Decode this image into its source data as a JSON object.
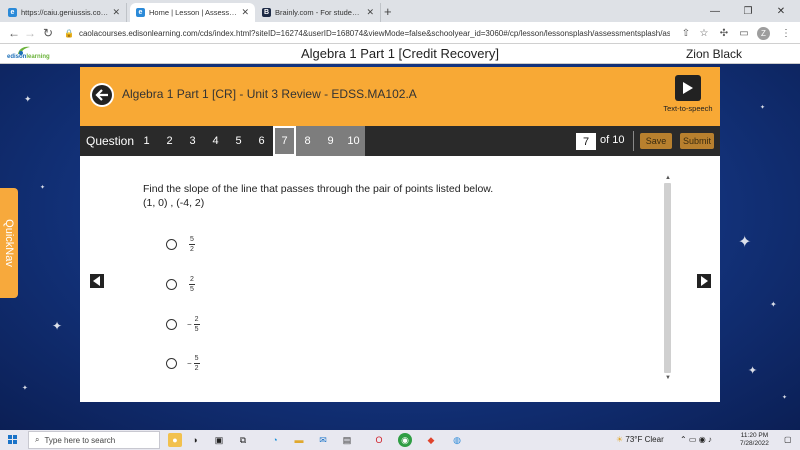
{
  "browser": {
    "tabs": [
      {
        "title": "https://caiu.geniussis.com/FEDash...",
        "favicon": "e",
        "favicon_color": "#2b8ad8",
        "active": false
      },
      {
        "title": "Home | Lesson | Assessment Player",
        "favicon": "e",
        "favicon_color": "#2b8ad8",
        "active": true
      },
      {
        "title": "Brainly.com - For students. By stu...",
        "favicon": "B",
        "favicon_color": "#1d2a45",
        "active": false
      }
    ],
    "new_tab": "+",
    "url": "caolacourses.edisonlearning.com/cds/index.html?siteID=16274&userID=168074&viewMode=false&schoolyear_id=3060#/cp/lesson/lessonsplash/assessmentsplash/assessmentplayer",
    "profile_initial": "Z"
  },
  "site": {
    "logo_word_a": "edison",
    "logo_word_b": "learning",
    "course_title": "Algebra 1 Part 1 [Credit Recovery]",
    "user_name": "Zion Black"
  },
  "quicknav": {
    "label": "QuickNav"
  },
  "lesson": {
    "title": "Algebra 1 Part 1 [CR] - Unit 3 Review - EDSS.MA102.A",
    "tts_label": "Text-to-speech"
  },
  "question_bar": {
    "label": "Question",
    "numbers": [
      "1",
      "2",
      "3",
      "4",
      "5",
      "6",
      "7",
      "8",
      "9",
      "10"
    ],
    "current": "7",
    "current_page": "7",
    "of_label": "of 10",
    "save_label": "Save",
    "submit_label": "Submit"
  },
  "question": {
    "prompt": "Find the slope of the line that passes through the pair of points listed below.",
    "points": "(1, 0) , (-4, 2)",
    "choices": [
      {
        "sign": "",
        "num": "5",
        "den": "2"
      },
      {
        "sign": "",
        "num": "2",
        "den": "5"
      },
      {
        "sign": "−",
        "num": "2",
        "den": "5"
      },
      {
        "sign": "−",
        "num": "5",
        "den": "2"
      }
    ]
  },
  "taskbar": {
    "search_placeholder": "Type here to search",
    "weather": "73°F  Clear",
    "time": "11:20 PM",
    "date": "7/28/2022"
  },
  "colors": {
    "accent_orange": "#f8a935",
    "question_bar": "#2a2a2a",
    "button_brown": "#b8802e"
  }
}
